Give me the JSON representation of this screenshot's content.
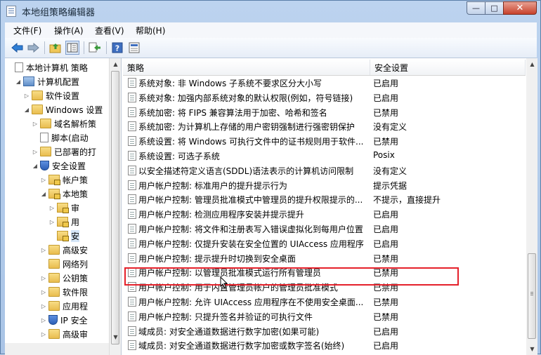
{
  "window": {
    "title": "本地组策略编辑器"
  },
  "titlebar_buttons": {
    "minimize": "—",
    "maximize": "□",
    "close": "✕"
  },
  "menu": [
    {
      "label": "文件(F)"
    },
    {
      "label": "操作(A)"
    },
    {
      "label": "查看(V)"
    },
    {
      "label": "帮助(H)"
    }
  ],
  "toolbar": {
    "icons": [
      "back-arrow-icon",
      "forward-arrow-icon",
      "up-folder-icon",
      "show-tree-icon",
      "export-list-icon",
      "help-icon",
      "properties-icon"
    ]
  },
  "tree": [
    {
      "label": "本地计算机 策略",
      "icon": "doc",
      "toggle": "",
      "indent": 0
    },
    {
      "label": "计算机配置",
      "icon": "comp",
      "toggle": "◢",
      "indent": 1
    },
    {
      "label": "软件设置",
      "icon": "folder",
      "toggle": "▷",
      "indent": 2
    },
    {
      "label": "Windows 设置",
      "icon": "folder",
      "toggle": "◢",
      "indent": 2
    },
    {
      "label": "域名解析策",
      "icon": "folder",
      "toggle": "▷",
      "indent": 3
    },
    {
      "label": "脚本(启动",
      "icon": "doc",
      "toggle": "",
      "indent": 3
    },
    {
      "label": "已部署的打",
      "icon": "folder",
      "toggle": "▷",
      "indent": 3
    },
    {
      "label": "安全设置",
      "icon": "shield",
      "toggle": "◢",
      "indent": 3
    },
    {
      "label": "帐户策",
      "icon": "folder-lock",
      "toggle": "▷",
      "indent": 4
    },
    {
      "label": "本地策",
      "icon": "folder-lock",
      "toggle": "◢",
      "indent": 4
    },
    {
      "label": "审",
      "icon": "folder-lock",
      "toggle": "▷",
      "indent": 5
    },
    {
      "label": "用",
      "icon": "folder-lock",
      "toggle": "▷",
      "indent": 5
    },
    {
      "label": "安",
      "icon": "folder-lock",
      "toggle": "",
      "indent": 5,
      "selected": true
    },
    {
      "label": "高级安",
      "icon": "folder",
      "toggle": "▷",
      "indent": 4
    },
    {
      "label": "网络列",
      "icon": "folder",
      "toggle": "",
      "indent": 4
    },
    {
      "label": "公钥策",
      "icon": "folder",
      "toggle": "▷",
      "indent": 4
    },
    {
      "label": "软件限",
      "icon": "folder",
      "toggle": "▷",
      "indent": 4
    },
    {
      "label": "应用程",
      "icon": "folder",
      "toggle": "▷",
      "indent": 4
    },
    {
      "label": "IP 安全",
      "icon": "shield",
      "toggle": "▷",
      "indent": 4
    },
    {
      "label": "高级审",
      "icon": "folder",
      "toggle": "▷",
      "indent": 4
    }
  ],
  "columns": {
    "policy": "策略",
    "setting": "安全设置"
  },
  "rows": [
    {
      "policy": "系统对象: 非 Windows 子系统不要求区分大小写",
      "setting": "已启用"
    },
    {
      "policy": "系统对象: 加强内部系统对象的默认权限(例如，符号链接)",
      "setting": "已启用"
    },
    {
      "policy": "系统加密: 将 FIPS 兼容算法用于加密、哈希和签名",
      "setting": "已禁用"
    },
    {
      "policy": "系统加密: 为计算机上存储的用户密钥强制进行强密钥保护",
      "setting": "没有定义"
    },
    {
      "policy": "系统设置: 将 Windows 可执行文件中的证书规则用于软件...",
      "setting": "已禁用"
    },
    {
      "policy": "系统设置: 可选子系统",
      "setting": "Posix"
    },
    {
      "policy": "以安全描述符定义语言(SDDL)语法表示的计算机访问限制",
      "setting": "没有定义"
    },
    {
      "policy": "用户帐户控制: 标准用户的提升提示行为",
      "setting": "提示凭据"
    },
    {
      "policy": "用户帐户控制: 管理员批准模式中管理员的提升权限提示的...",
      "setting": "不提示，直接提升"
    },
    {
      "policy": "用户帐户控制: 检测应用程序安装并提示提升",
      "setting": "已启用"
    },
    {
      "policy": "用户帐户控制: 将文件和注册表写入错误虚拟化到每用户位置",
      "setting": "已启用"
    },
    {
      "policy": "用户帐户控制: 仅提升安装在安全位置的 UIAccess 应用程序",
      "setting": "已启用"
    },
    {
      "policy": "用户帐户控制: 提示提升时切换到安全桌面",
      "setting": "已禁用"
    },
    {
      "policy": "用户帐户控制: 以管理员批准模式运行所有管理员",
      "setting": "已禁用"
    },
    {
      "policy": "用户帐户控制: 用于内置管理员帐户的管理员批准模式",
      "setting": "已禁用"
    },
    {
      "policy": "用户帐户控制: 允许 UIAccess 应用程序在不使用安全桌面...",
      "setting": "已禁用"
    },
    {
      "policy": "用户帐户控制: 只提升签名并验证的可执行文件",
      "setting": "已禁用"
    },
    {
      "policy": "域成员: 对安全通道数据进行数字加密(如果可能)",
      "setting": "已启用"
    },
    {
      "policy": "域成员: 对安全通道数据进行数字加密或数字签名(始终)",
      "setting": "已启用"
    }
  ],
  "highlight_color": "#e5202a"
}
